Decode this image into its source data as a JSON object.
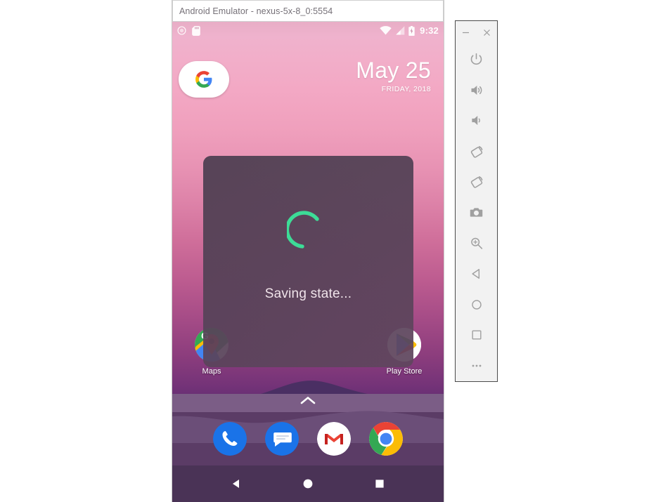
{
  "window": {
    "title": "Android Emulator - nexus-5x-8_0:5554",
    "minimize_label": "–",
    "close_label": "×"
  },
  "phone": {
    "status_bar": {
      "left_icons": [
        {
          "name": "screen-record-icon",
          "label": "screen record"
        },
        {
          "name": "sd-card-icon",
          "label": "sd card"
        }
      ],
      "right_icons": [
        {
          "name": "wifi-icon",
          "label": "wifi"
        },
        {
          "name": "cellular-signal-icon",
          "label": "cellular signal"
        },
        {
          "name": "battery-charging-icon",
          "label": "battery charging"
        }
      ],
      "time": "9:32"
    },
    "google_widget": {
      "logo_letter": "G",
      "colors": {
        "red": "#EA4335",
        "yellow": "#FBBC05",
        "green": "#34A853",
        "blue": "#4285F4"
      }
    },
    "date_widget": {
      "date": "May 25",
      "subtitle": "FRIDAY, 2018"
    },
    "apps": [
      {
        "name": "maps",
        "label": "Maps"
      },
      {
        "name": "play-store",
        "label": "Play Store"
      }
    ],
    "drawer_hint": "app drawer",
    "dock": [
      {
        "name": "phone",
        "label": "Phone"
      },
      {
        "name": "messages",
        "label": "Messages"
      },
      {
        "name": "gmail",
        "label": "Gmail"
      },
      {
        "name": "chrome",
        "label": "Chrome"
      }
    ],
    "nav_bar": [
      {
        "name": "back",
        "label": "Back"
      },
      {
        "name": "home",
        "label": "Home"
      },
      {
        "name": "recents",
        "label": "Recents"
      }
    ],
    "overlay": {
      "message": "Saving state...",
      "spinner_color": "#3DDC97",
      "background": "#554458"
    },
    "wallpaper": {
      "sky_top": "#EFB2CD",
      "sky_mid": "#E893B4",
      "sky_bottom": "#632E72",
      "ground": "#5B3C66",
      "nav_bar": "#4A3356"
    }
  },
  "toolbar": {
    "buttons": [
      {
        "name": "power",
        "label": "Power"
      },
      {
        "name": "volume-up",
        "label": "Volume Up"
      },
      {
        "name": "volume-down",
        "label": "Volume Down"
      },
      {
        "name": "rotate-left",
        "label": "Rotate Left"
      },
      {
        "name": "rotate-right",
        "label": "Rotate Right"
      },
      {
        "name": "screenshot",
        "label": "Take Screenshot"
      },
      {
        "name": "zoom",
        "label": "Enable Zoom"
      },
      {
        "name": "back",
        "label": "Back"
      },
      {
        "name": "home",
        "label": "Home"
      },
      {
        "name": "overview",
        "label": "Overview"
      },
      {
        "name": "more",
        "label": "More"
      }
    ]
  }
}
